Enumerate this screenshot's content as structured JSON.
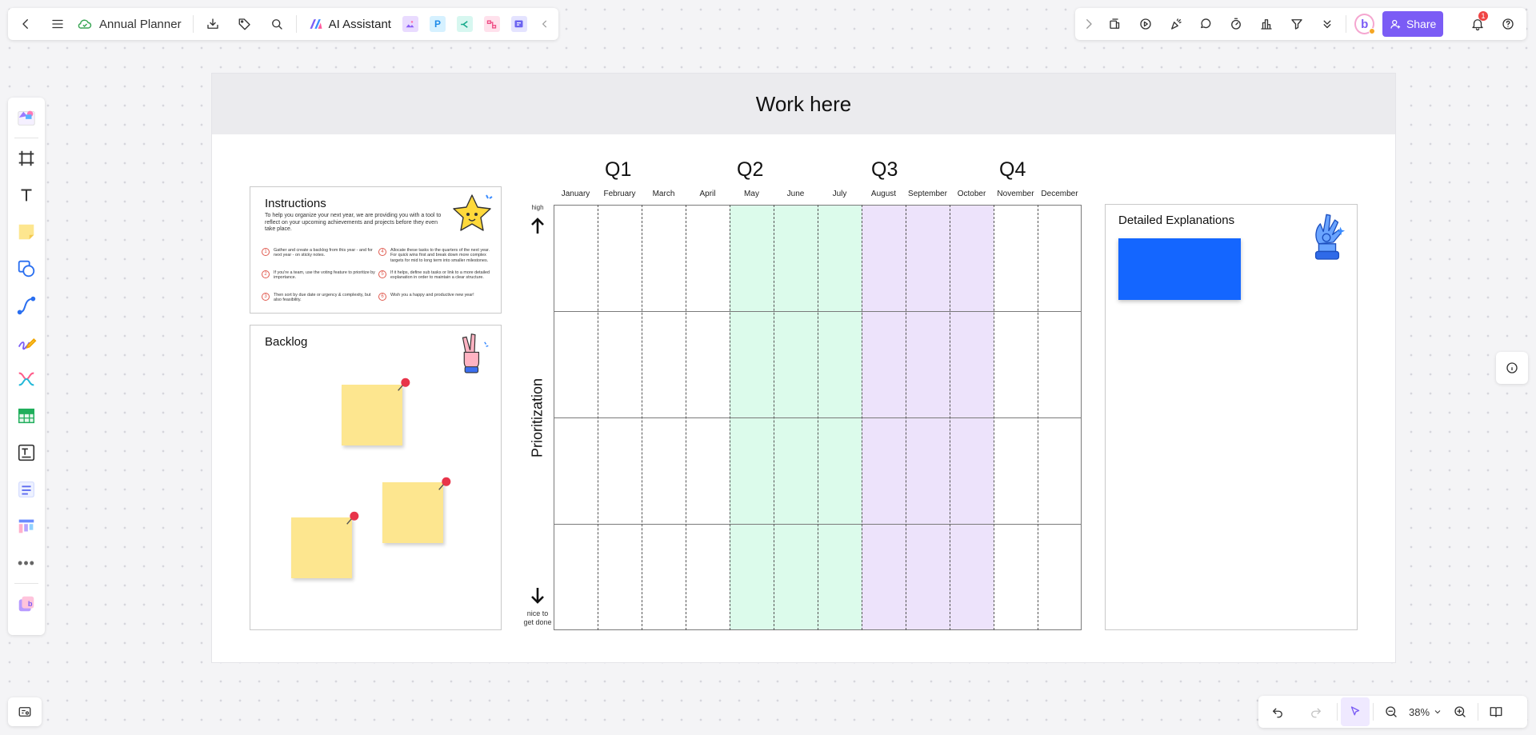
{
  "header": {
    "doc_title": "Annual Planner",
    "ai_label": "AI Assistant",
    "share_label": "Share",
    "notification_count": "1",
    "user_initial": "b"
  },
  "zoom": {
    "level": "38%"
  },
  "frame": {
    "title": "Work here"
  },
  "instructions": {
    "title": "Instructions",
    "intro": "To help you organize your next year, we are providing you with a tool to reflect on your upcoming achievements and projects before they even take place.",
    "steps": [
      {
        "num": "1",
        "text": "Gather and create a backlog from this year - and for next year - on sticky notes."
      },
      {
        "num": "2",
        "text": "If you're a team, use the voting feature to prioritize by importance."
      },
      {
        "num": "3",
        "text": "Then sort by due date or urgency & complexity, but also feasibility."
      },
      {
        "num": "4",
        "text": "Allocate these tasks to the quarters of the next year. For quick wins first and break down more complex targets for mid to long term into smaller milestones."
      },
      {
        "num": "5",
        "text": "If it helps, define sub tasks or link to a more detailed explanation in order to maintain a clear structure."
      },
      {
        "num": "6",
        "text": "Wish you a happy and productive new year!"
      }
    ]
  },
  "backlog": {
    "title": "Backlog"
  },
  "explanations": {
    "title": "Detailed Explanations"
  },
  "planner": {
    "quarters": [
      "Q1",
      "Q2",
      "Q3",
      "Q4"
    ],
    "months": [
      "January",
      "February",
      "March",
      "April",
      "May",
      "June",
      "July",
      "August",
      "September",
      "October",
      "November",
      "December"
    ],
    "axis_label": "Prioritization",
    "high_label": "high",
    "low_label_1": "nice to",
    "low_label_2": "get done"
  },
  "colors": {
    "accent": "#7b5cf5",
    "q2_fill": "#dcfbeb",
    "q3_fill": "#ede3fb",
    "sticky": "#fde68f",
    "blue_card": "#1466ff"
  },
  "icons": {
    "back": "chevron-left-icon",
    "menu": "menu-icon",
    "cloud": "cloud-icon",
    "download": "download-icon",
    "tag": "tag-icon",
    "search": "search-icon"
  }
}
